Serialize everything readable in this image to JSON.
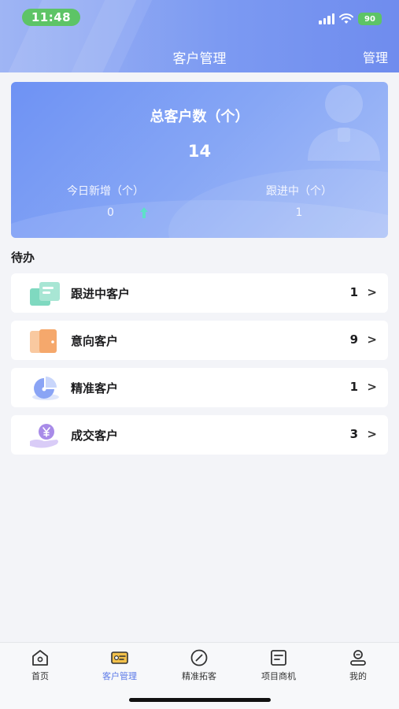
{
  "status_bar": {
    "time": "11:48",
    "battery": "90"
  },
  "nav": {
    "title": "客户管理",
    "manage": "管理"
  },
  "summary": {
    "total_label": "总客户数（个）",
    "total_value": "14",
    "today_new_label": "今日新增（个）",
    "today_new_value": "0",
    "following_label": "跟进中（个）",
    "following_value": "1"
  },
  "todo": {
    "title": "待办",
    "items": [
      {
        "label": "跟进中客户",
        "count": "1",
        "arrow": ">",
        "icon": "follow-card-icon"
      },
      {
        "label": "意向客户",
        "count": "9",
        "arrow": ">",
        "icon": "intent-door-icon"
      },
      {
        "label": "精准客户",
        "count": "1",
        "arrow": ">",
        "icon": "precise-target-icon"
      },
      {
        "label": "成交客户",
        "count": "3",
        "arrow": ">",
        "icon": "deal-yen-icon"
      }
    ]
  },
  "tabbar": {
    "items": [
      {
        "label": "首页",
        "icon": "home-icon"
      },
      {
        "label": "客户管理",
        "icon": "customer-icon"
      },
      {
        "label": "精准拓客",
        "icon": "compass-icon"
      },
      {
        "label": "项目商机",
        "icon": "document-icon"
      },
      {
        "label": "我的",
        "icon": "profile-icon"
      }
    ],
    "active_index": 1
  },
  "colors": {
    "accent": "#5b79e8",
    "status_green": "#5dc466",
    "background": "#f3f4f8"
  }
}
